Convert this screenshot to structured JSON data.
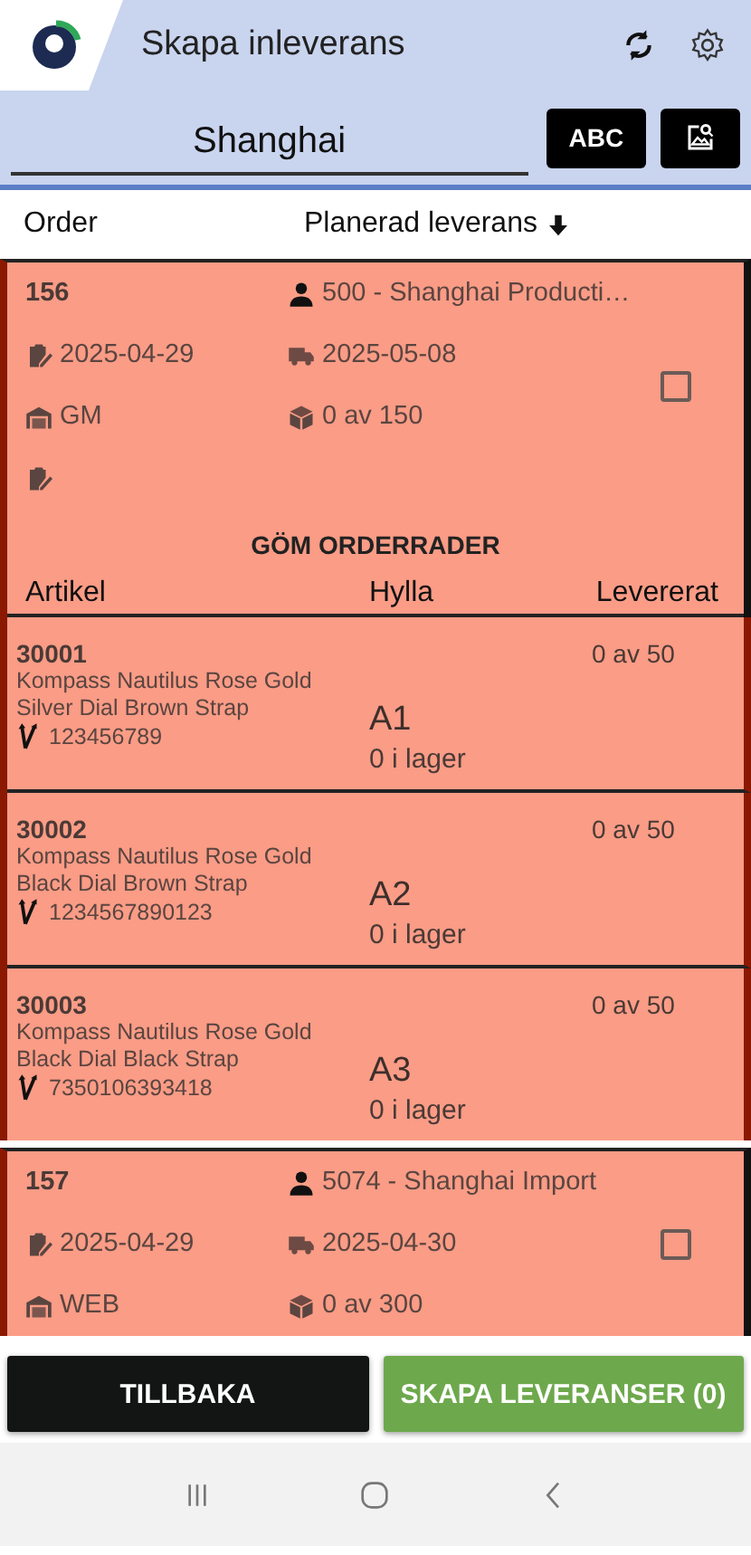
{
  "app_bar": {
    "title": "Skapa inleverans"
  },
  "search": {
    "value": "Shanghai",
    "mode_button": "ABC"
  },
  "columns": {
    "order": "Order",
    "planned": "Planerad leverans"
  },
  "orders": [
    {
      "number": "156",
      "customer": "500 - Shanghai Producti…",
      "order_date": "2025-04-29",
      "delivery_date": "2025-05-08",
      "warehouse": "GM",
      "quantity": "0 av 150",
      "note_row": true,
      "checked": false,
      "expanded": true,
      "toggle_label": "GÖM ORDERRADER",
      "line_columns": [
        "Artikel",
        "Hylla",
        "Levererat"
      ],
      "lines": [
        {
          "article": "30001",
          "description": "Kompass Nautilus Rose Gold Silver Dial Brown Strap",
          "barcode": "123456789",
          "shelf": "A1",
          "stock": "0 i lager",
          "delivered": "0 av 50"
        },
        {
          "article": "30002",
          "description": "Kompass Nautilus Rose Gold Black Dial Brown Strap",
          "barcode": "1234567890123",
          "shelf": "A2",
          "stock": "0 i lager",
          "delivered": "0 av 50"
        },
        {
          "article": "30003",
          "description": "Kompass Nautilus Rose Gold Black Dial Black Strap",
          "barcode": "7350106393418",
          "shelf": "A3",
          "stock": "0 i lager",
          "delivered": "0 av 50"
        }
      ]
    },
    {
      "number": "157",
      "customer": "5074 - Shanghai Import",
      "order_date": "2025-04-29",
      "delivery_date": "2025-04-30",
      "warehouse": "WEB",
      "quantity": "0 av 300",
      "note_row": false,
      "checked": false,
      "expanded": false
    }
  ],
  "buttons": {
    "back": "TILLBAKA",
    "create": "SKAPA LEVERANSER (0)"
  }
}
